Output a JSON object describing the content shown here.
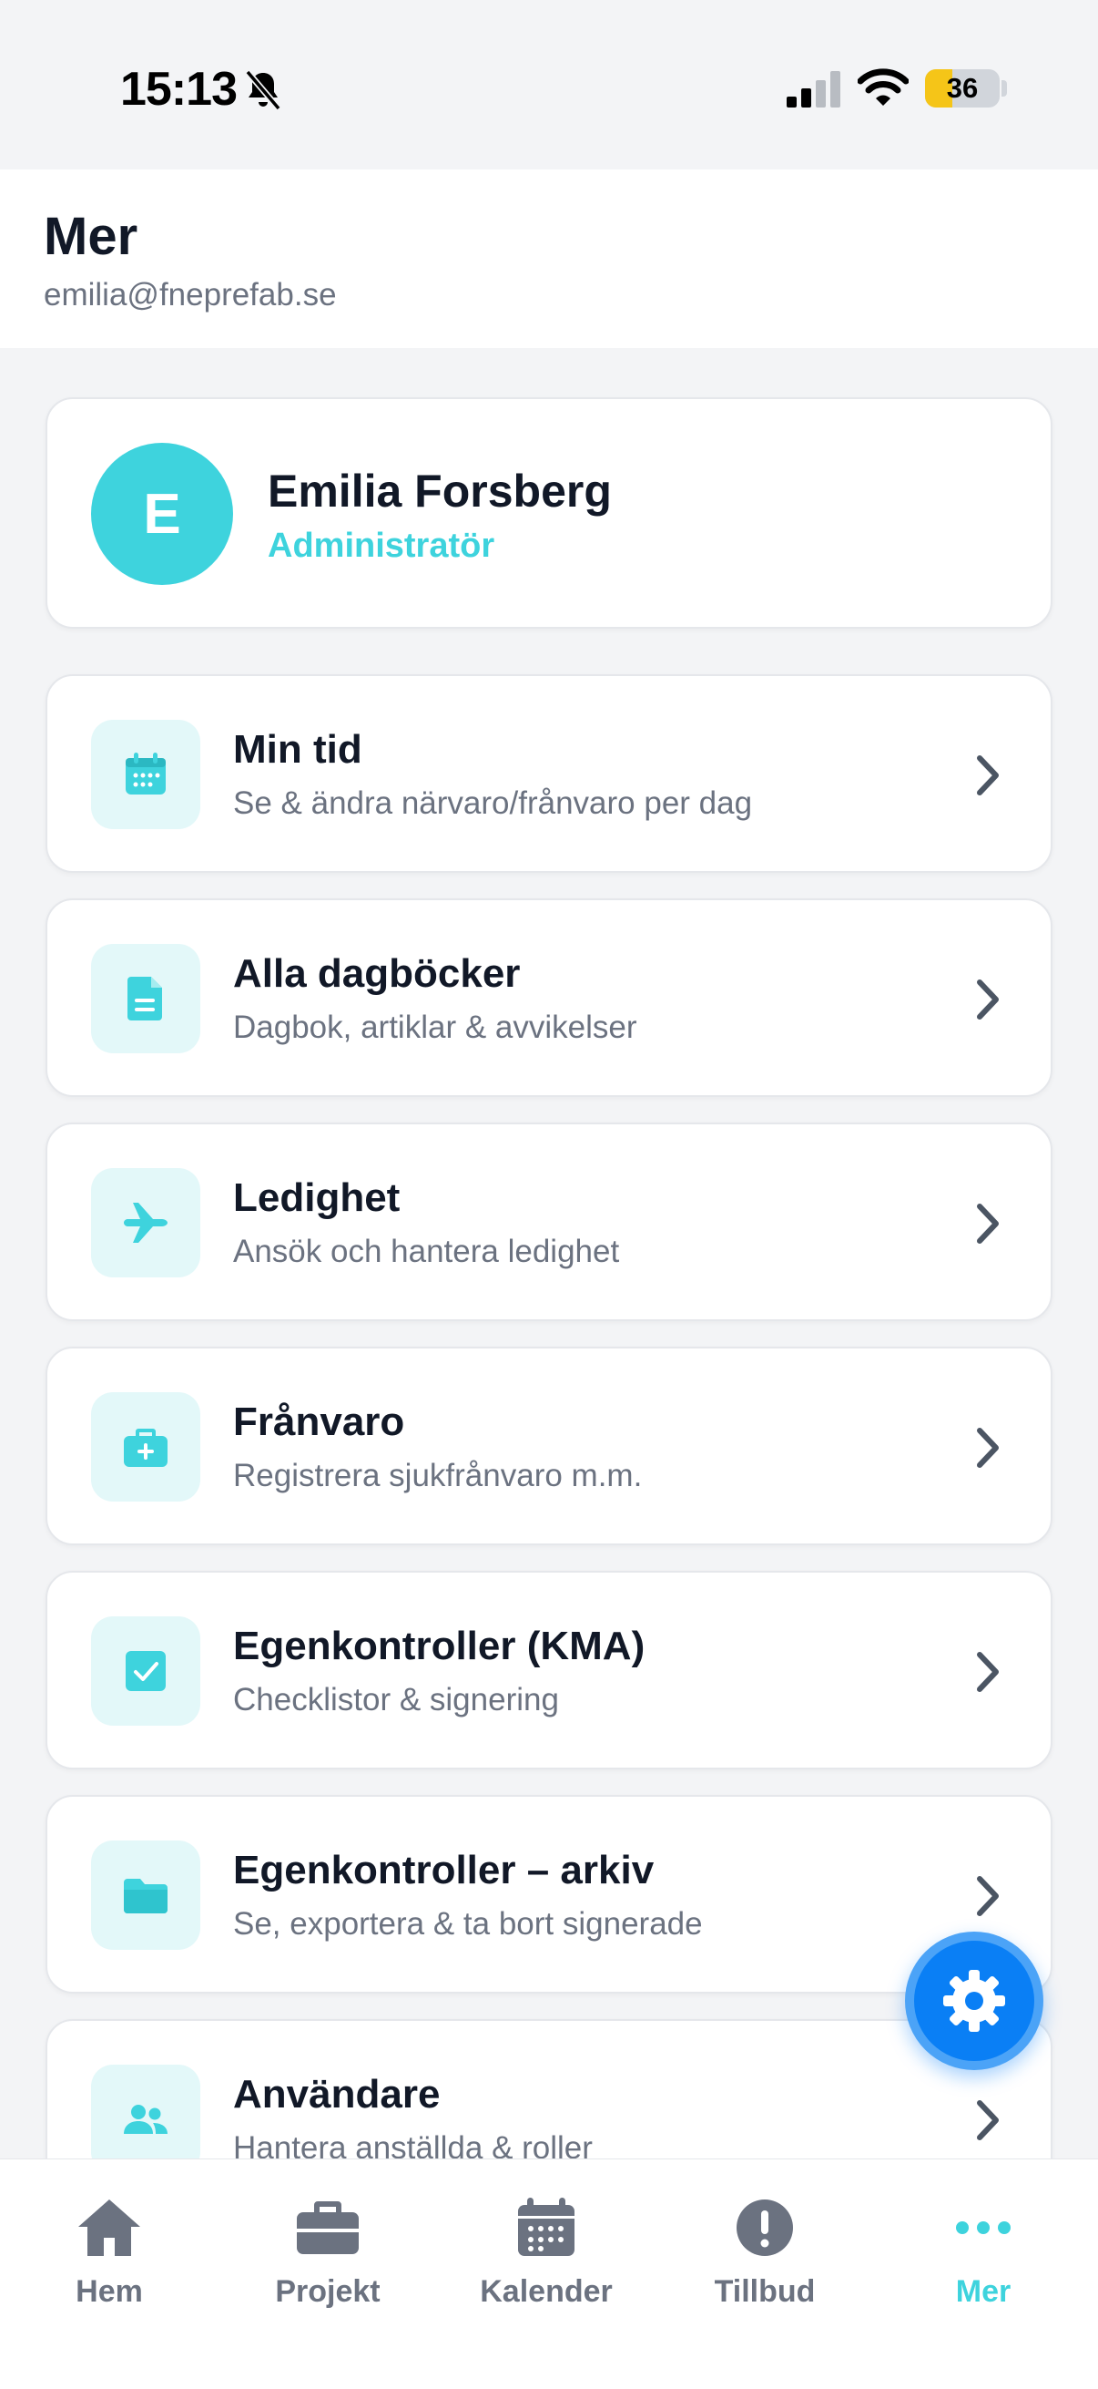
{
  "status_bar": {
    "time": "15:13",
    "battery": "36",
    "battery_level": 0.36
  },
  "header": {
    "title": "Mer",
    "email": "emilia@fneprefab.se"
  },
  "profile": {
    "initial": "E",
    "name": "Emilia Forsberg",
    "role": "Administratör"
  },
  "menu": [
    {
      "icon": "calendar-icon",
      "title": "Min tid",
      "subtitle": "Se & ändra närvaro/frånvaro per dag"
    },
    {
      "icon": "document-icon",
      "title": "Alla dagböcker",
      "subtitle": "Dagbok, artiklar & avvikelser"
    },
    {
      "icon": "airplane-icon",
      "title": "Ledighet",
      "subtitle": "Ansök och hantera ledighet"
    },
    {
      "icon": "medical-kit-icon",
      "title": "Frånvaro",
      "subtitle": "Registrera sjukfrånvaro m.m."
    },
    {
      "icon": "checkbox-icon",
      "title": "Egenkontroller (KMA)",
      "subtitle": "Checklistor & signering"
    },
    {
      "icon": "folder-icon",
      "title": "Egenkontroller – arkiv",
      "subtitle": "Se, exportera & ta bort signerade"
    },
    {
      "icon": "users-icon",
      "title": "Användare",
      "subtitle": "Hantera anställda & roller"
    }
  ],
  "fab": {
    "icon": "gear-icon"
  },
  "tabs": [
    {
      "icon": "home-icon",
      "label": "Hem"
    },
    {
      "icon": "briefcase-icon",
      "label": "Projekt"
    },
    {
      "icon": "calendar-icon",
      "label": "Kalender"
    },
    {
      "icon": "alert-icon",
      "label": "Tillbud"
    },
    {
      "icon": "more-icon",
      "label": "Mer",
      "active": true
    }
  ],
  "colors": {
    "accent": "#3ed3dd",
    "icon_bg": "#e3f8f9",
    "fab": "#0a7ff5",
    "text": "#111827",
    "muted": "#6b7280",
    "tab_inactive": "#6b7280",
    "battery": "#f5c518"
  }
}
